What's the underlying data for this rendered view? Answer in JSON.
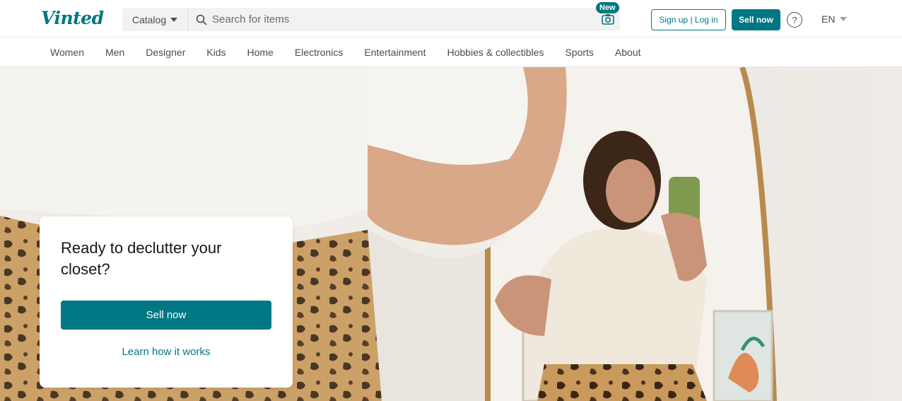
{
  "header": {
    "logo": "Vinted",
    "catalog_label": "Catalog",
    "search_placeholder": "Search for items",
    "new_badge": "New",
    "signup_login_label": "Sign up | Log in",
    "sell_now_label": "Sell now",
    "help_icon": "question-circle-icon",
    "language": "EN"
  },
  "nav": {
    "categories": [
      "Women",
      "Men",
      "Designer",
      "Kids",
      "Home",
      "Electronics",
      "Entertainment",
      "Hobbies & collectibles",
      "Sports",
      "About"
    ]
  },
  "hero": {
    "heading": "Ready to declutter your closet?",
    "sell_button": "Sell now",
    "learn_link": "Learn how it works"
  },
  "colors": {
    "brand": "#007782",
    "text": "#171717",
    "muted": "#4d4d4d"
  }
}
